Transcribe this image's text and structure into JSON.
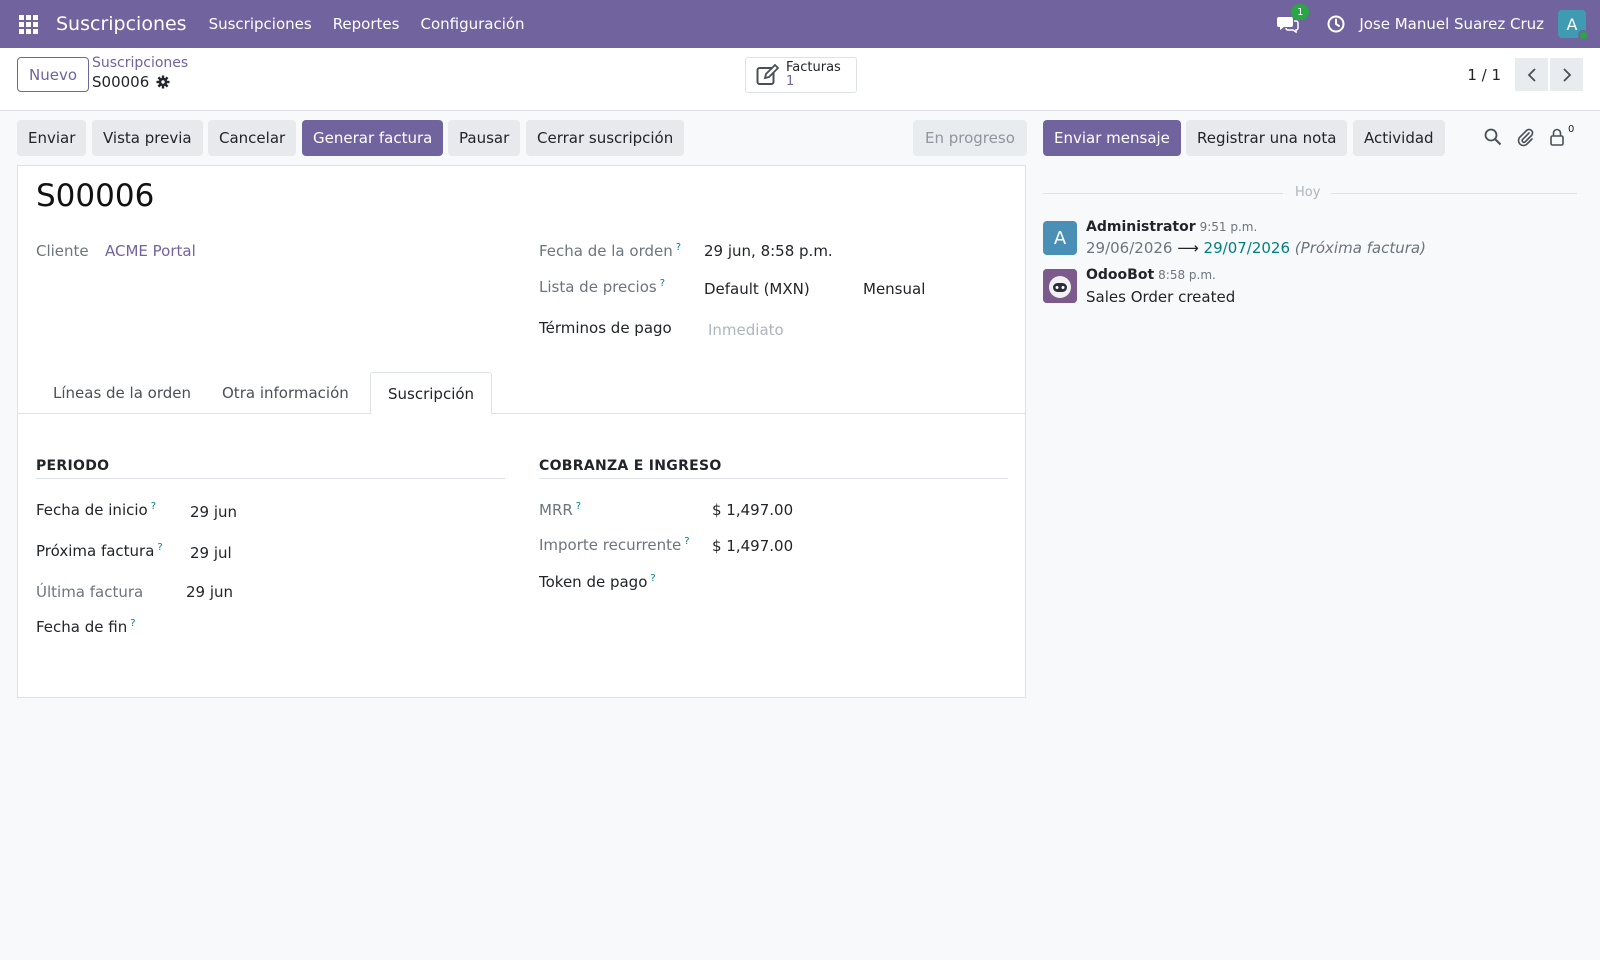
{
  "navbar": {
    "app_title": "Suscripciones",
    "menu": [
      "Suscripciones",
      "Reportes",
      "Configuración"
    ],
    "chat_badge": "1",
    "user_name": "Jose Manuel Suarez Cruz",
    "user_initial": "A",
    "color": "#71639e"
  },
  "control": {
    "new_label": "Nuevo",
    "breadcrumb_parent": "Suscripciones",
    "breadcrumb_current": "S00006",
    "smart_button": {
      "label": "Facturas",
      "count": "1"
    },
    "pager": "1 / 1"
  },
  "status_bar": {
    "buttons": [
      "Enviar",
      "Vista previa",
      "Cancelar",
      "Generar factura",
      "Pausar",
      "Cerrar suscripción"
    ],
    "state": "En progreso"
  },
  "form": {
    "title": "S00006",
    "customer": {
      "label": "Cliente",
      "value": "ACME Portal"
    },
    "order_date": {
      "label": "Fecha de la orden",
      "help": "?",
      "value": "29 jun, 8:58 p.m."
    },
    "pricelist": {
      "label": "Lista de precios",
      "help": "?",
      "value": "Default (MXN)",
      "plan": "Mensual"
    },
    "payment_terms": {
      "label": "Términos de pago",
      "placeholder": "Inmediato"
    },
    "tabs": [
      "Líneas de la orden",
      "Otra información",
      "Suscripción"
    ],
    "active_tab": "Suscripción",
    "period": {
      "title": "PERIODO",
      "start_date": {
        "label": "Fecha de inicio",
        "help": "?",
        "value": "29 jun"
      },
      "next_invoice": {
        "label": "Próxima factura",
        "help": "?",
        "value": "29 jul"
      },
      "last_invoice": {
        "label": "Última factura",
        "value": "29 jun"
      },
      "end_date": {
        "label": "Fecha de fin",
        "help": "?"
      }
    },
    "billing": {
      "title": "COBRANZA E INGRESO",
      "mrr": {
        "label": "MRR",
        "help": "?",
        "value": "$ 1,497.00"
      },
      "recurring": {
        "label": "Importe recurrente",
        "help": "?",
        "value": "$ 1,497.00"
      },
      "token": {
        "label": "Token de pago",
        "help": "?"
      }
    }
  },
  "chatter": {
    "send_message": "Enviar mensaje",
    "log_note": "Registrar una nota",
    "activity": "Actividad",
    "followers_count": "0",
    "date_separator": "Hoy",
    "messages": [
      {
        "author": "Administrator",
        "initial": "A",
        "time": "9:51 p.m.",
        "old_value": "29/06/2026",
        "arrow": "⟶",
        "new_value": "29/07/2026",
        "field": "(Próxima factura)"
      },
      {
        "author": "OdooBot",
        "time": "8:58 p.m.",
        "body": "Sales Order created"
      }
    ]
  }
}
